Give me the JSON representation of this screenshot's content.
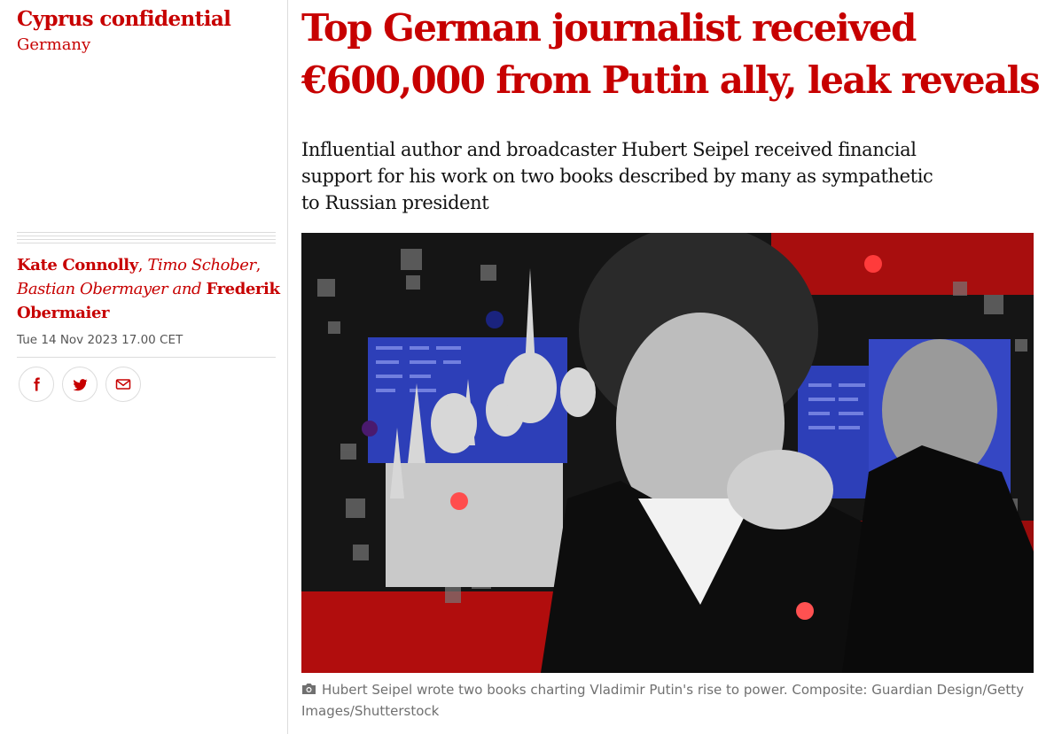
{
  "series": {
    "title": "Cyprus confidential",
    "section": "Germany"
  },
  "byline": {
    "author1": "Kate Connolly",
    "sep1": ", ",
    "author2": "Timo Schober",
    "sep2": ", ",
    "author3": "Bastian Obermayer",
    "conj": " and ",
    "author4": "Frederik Obermaier"
  },
  "dateline": "Tue 14 Nov 2023 17.00 CET",
  "share": {
    "facebook_icon": "facebook-icon",
    "twitter_icon": "twitter-icon",
    "email_icon": "email-icon"
  },
  "headline": "Top German journalist received €600,000 from Putin ally, leak reveals",
  "standfirst": "Influential author and broadcaster Hubert Seipel received financial support for his work on two books described by many as sympathetic to Russian president",
  "caption": {
    "icon": "camera-icon",
    "text": "Hubert Seipel wrote two books charting Vladimir Putin's rise to power. Composite: Guardian Design/Getty Images/Shutterstock"
  },
  "colors": {
    "brand_red": "#c70000",
    "text": "#121212",
    "muted": "#707070",
    "rule": "#dcdcdc",
    "image_red": "#b10d0d",
    "image_blue": "#2d3fb8"
  }
}
